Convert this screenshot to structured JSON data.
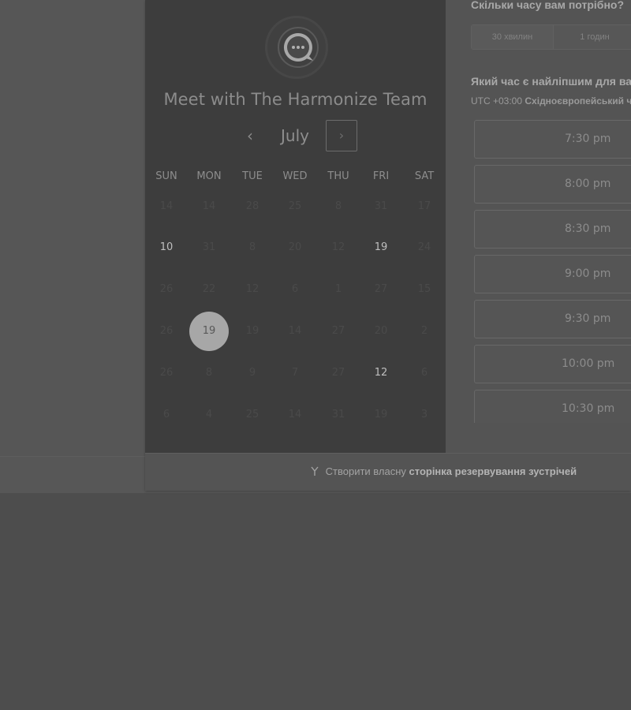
{
  "calendar": {
    "title": "Meet with The Harmonize Team",
    "month": "July",
    "prev_symbol": "‹",
    "next_symbol": "›",
    "weekdays": [
      "SUN",
      "MON",
      "TUE",
      "WED",
      "THU",
      "FRI",
      "SAT"
    ],
    "weeks": [
      [
        {
          "d": "14",
          "s": "inactive"
        },
        {
          "d": "14",
          "s": "inactive"
        },
        {
          "d": "28",
          "s": "inactive"
        },
        {
          "d": "25",
          "s": "inactive"
        },
        {
          "d": "8",
          "s": "inactive"
        },
        {
          "d": "31",
          "s": "inactive"
        },
        {
          "d": "17",
          "s": "inactive"
        }
      ],
      [
        {
          "d": "10",
          "s": "active"
        },
        {
          "d": "31",
          "s": "inactive"
        },
        {
          "d": "8",
          "s": "inactive"
        },
        {
          "d": "20",
          "s": "inactive"
        },
        {
          "d": "12",
          "s": "inactive"
        },
        {
          "d": "19",
          "s": "active"
        },
        {
          "d": "24",
          "s": "inactive"
        }
      ],
      [
        {
          "d": "26",
          "s": "inactive"
        },
        {
          "d": "22",
          "s": "inactive"
        },
        {
          "d": "12",
          "s": "inactive"
        },
        {
          "d": "6",
          "s": "inactive"
        },
        {
          "d": "1",
          "s": "inactive"
        },
        {
          "d": "27",
          "s": "inactive"
        },
        {
          "d": "15",
          "s": "inactive"
        }
      ],
      [
        {
          "d": "26",
          "s": "inactive"
        },
        {
          "d": "19",
          "s": "selected"
        },
        {
          "d": "19",
          "s": "inactive"
        },
        {
          "d": "14",
          "s": "inactive"
        },
        {
          "d": "27",
          "s": "inactive"
        },
        {
          "d": "20",
          "s": "inactive"
        },
        {
          "d": "2",
          "s": "inactive"
        }
      ],
      [
        {
          "d": "26",
          "s": "inactive"
        },
        {
          "d": "8",
          "s": "inactive"
        },
        {
          "d": "9",
          "s": "inactive"
        },
        {
          "d": "7",
          "s": "inactive"
        },
        {
          "d": "27",
          "s": "inactive"
        },
        {
          "d": "12",
          "s": "active"
        },
        {
          "d": "6",
          "s": "inactive"
        }
      ],
      [
        {
          "d": "6",
          "s": "inactive"
        },
        {
          "d": "4",
          "s": "inactive"
        },
        {
          "d": "25",
          "s": "inactive"
        },
        {
          "d": "14",
          "s": "inactive"
        },
        {
          "d": "31",
          "s": "inactive"
        },
        {
          "d": "19",
          "s": "inactive"
        },
        {
          "d": "3",
          "s": "inactive"
        }
      ]
    ]
  },
  "booking": {
    "duration_question": "Скільки часу вам потрібно?",
    "durations": [
      "30 хвилин",
      "1 годин"
    ],
    "time_question": "Який час є найліпшим для вас?",
    "tz_offset": "UTC +03:00",
    "tz_name": "Східноєвропейський час",
    "time_slots": [
      "7:30 pm",
      "8:00 pm",
      "8:30 pm",
      "9:00 pm",
      "9:30 pm",
      "10:00 pm",
      "10:30 pm"
    ]
  },
  "footer": {
    "link_prefix": "Створити власну",
    "link_bold": "сторінка резервування зустрічей"
  }
}
